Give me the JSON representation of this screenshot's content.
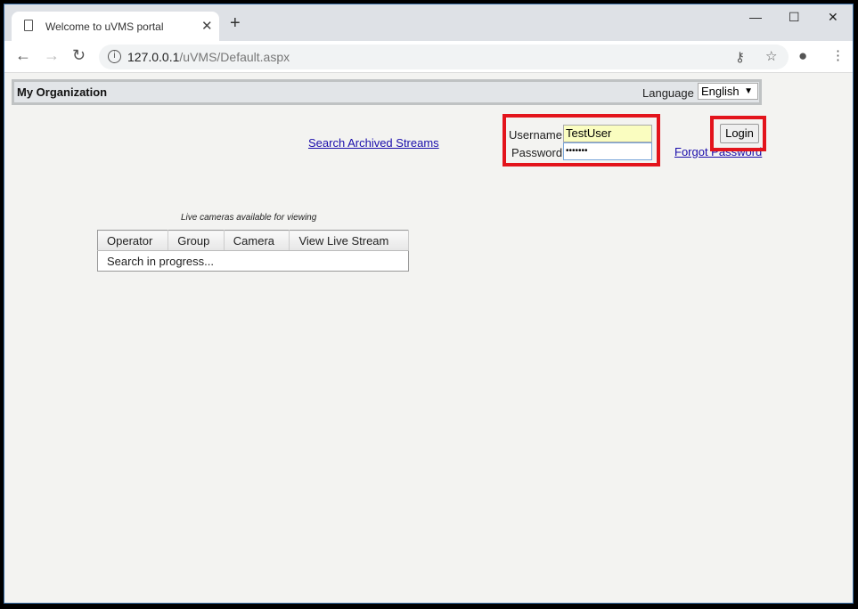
{
  "browser": {
    "tab_title": "Welcome to uVMS portal",
    "url_host": "127.0.0.1",
    "url_path": "/uVMS/Default.aspx"
  },
  "header": {
    "org_name": "My Organization",
    "language_label": "Language",
    "language_value": "English"
  },
  "login": {
    "search_link": "Search Archived Streams",
    "username_label": "Username",
    "username_value": "TestUser",
    "password_label": "Password",
    "password_value": "•••••••",
    "login_button": "Login",
    "forgot_link": "Forgot Password"
  },
  "cameras": {
    "caption": "Live cameras available for viewing",
    "columns": [
      "Operator",
      "Group",
      "Camera",
      "View Live Stream"
    ],
    "status": "Search in progress..."
  },
  "colors": {
    "highlight": "#e3141c",
    "link": "#1a0dab"
  }
}
